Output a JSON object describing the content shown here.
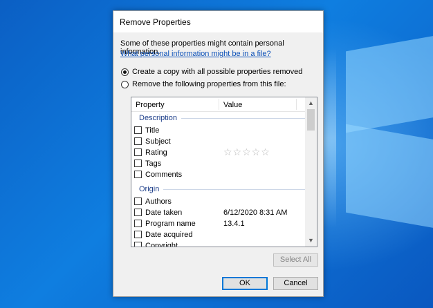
{
  "dialog": {
    "title": "Remove Properties",
    "info_text": "Some of these properties might contain personal information.",
    "info_link": "What personal information might be in a file?",
    "options": [
      {
        "label": "Create a copy with all possible properties removed",
        "selected": true
      },
      {
        "label": "Remove the following properties from this file:",
        "selected": false
      }
    ],
    "list": {
      "columns": [
        "Property",
        "Value"
      ],
      "groups": [
        {
          "name": "Description",
          "rows": [
            {
              "label": "Title",
              "value": ""
            },
            {
              "label": "Subject",
              "value": ""
            },
            {
              "label": "Rating",
              "value": "",
              "rating_stars": 0,
              "rating_max": 5
            },
            {
              "label": "Tags",
              "value": ""
            },
            {
              "label": "Comments",
              "value": ""
            }
          ]
        },
        {
          "name": "Origin",
          "rows": [
            {
              "label": "Authors",
              "value": ""
            },
            {
              "label": "Date taken",
              "value": "6/12/2020 8:31 AM"
            },
            {
              "label": "Program name",
              "value": "13.4.1"
            },
            {
              "label": "Date acquired",
              "value": ""
            },
            {
              "label": "Copyright",
              "value": ""
            }
          ]
        }
      ],
      "star_glyph": "☆☆☆☆☆"
    },
    "buttons": {
      "select_all": "Select All",
      "ok": "OK",
      "cancel": "Cancel"
    },
    "scroll_icons": {
      "up": "▲",
      "down": "▼"
    }
  },
  "colors": {
    "desktop_blue": "#0f7ee0",
    "link": "#0b50b8",
    "group_header": "#1e3f8a",
    "focus_border": "#0078d7"
  }
}
